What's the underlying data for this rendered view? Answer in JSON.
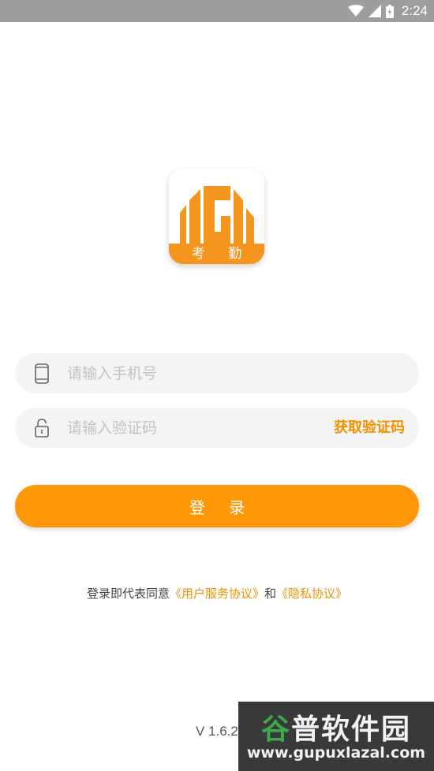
{
  "status_bar": {
    "time": "2:24",
    "icons": [
      "wifi-icon",
      "cell-signal-icon",
      "battery-icon"
    ]
  },
  "app_logo": {
    "label": "考 勤",
    "colors": {
      "brand": "#f5941e"
    }
  },
  "form": {
    "phone_placeholder": "请输入手机号",
    "phone_value": "",
    "code_placeholder": "请输入验证码",
    "code_value": "",
    "get_code_label": "获取验证码",
    "login_label": "登 录"
  },
  "agreement": {
    "prefix": "登录即代表同意",
    "terms_link": "《用户服务协议》",
    "conjunction": "和",
    "privacy_link": "《隐私协议》"
  },
  "version": "V 1.6.2",
  "watermark": {
    "title_accent": "谷",
    "title_rest": "普软件园",
    "url": "www.gupuxlazal.com"
  },
  "colors": {
    "accent": "#ff9808",
    "link": "#f29100",
    "field_bg": "#f4f4f4",
    "status_bar_bg": "#9e9e9e"
  }
}
